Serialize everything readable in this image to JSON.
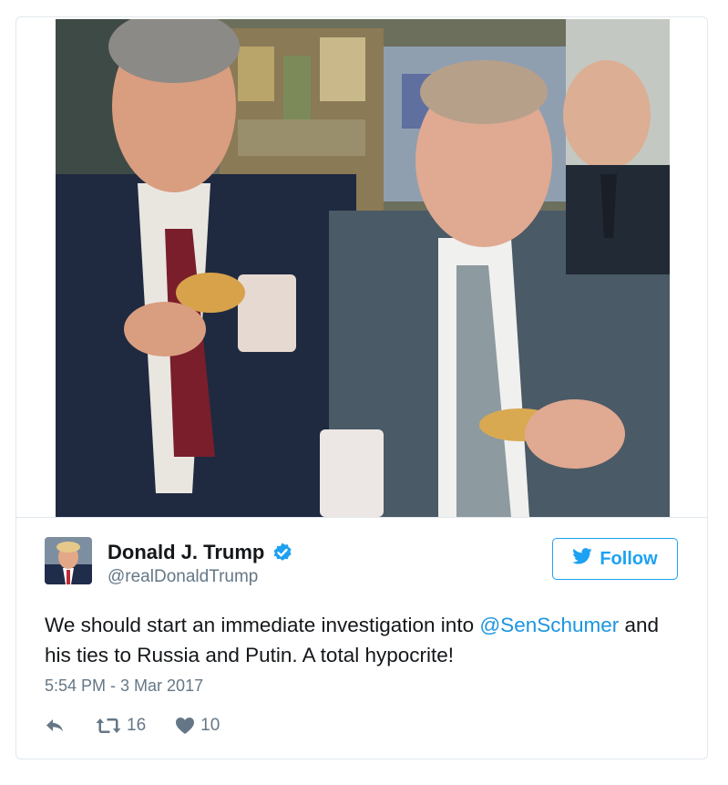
{
  "tweet": {
    "author_name": "Donald J. Trump",
    "author_handle": "@realDonaldTrump",
    "verified_icon": "verified-badge-icon",
    "follow_label": "Follow",
    "text_before": "We should start an immediate investigation into ",
    "mention": "@SenSchumer",
    "text_after": " and his ties to Russia and Putin. A total hypocrite!",
    "timestamp": "5:54 PM - 3 Mar 2017",
    "retweet_count": "16",
    "like_count": "10"
  },
  "colors": {
    "brand_blue": "#1da1f2",
    "mention_blue": "#1b95e0",
    "secondary_gray": "#657786",
    "border": "#e1e8ed"
  },
  "icons": [
    "reply-icon",
    "retweet-icon",
    "heart-icon",
    "bird-icon",
    "verified-badge-icon"
  ]
}
